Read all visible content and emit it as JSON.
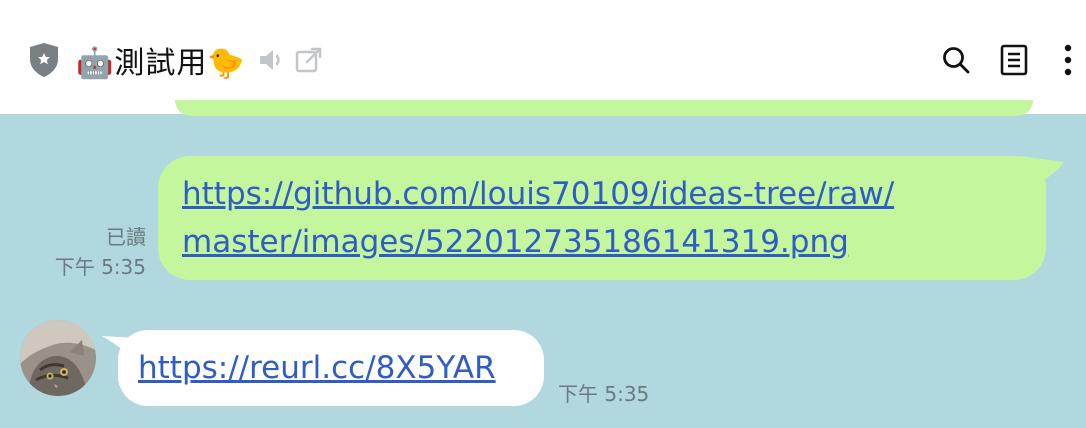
{
  "header": {
    "title": "🤖測試用🐤",
    "icons": [
      "shield-icon",
      "mute-icon",
      "external-link-icon",
      "search-icon",
      "notes-icon",
      "more-vertical-icon"
    ]
  },
  "messages": {
    "outgoing": {
      "link_line1": "https://github.com/louis70109/ideas-tree/raw/",
      "link_line2": "master/images/522012735186141319.png",
      "read_label": "已讀",
      "time": "下午 5:35"
    },
    "incoming": {
      "link": "https://reurl.cc/8X5YAR",
      "time": "下午 5:35"
    }
  },
  "colors": {
    "chat_background": "#b0d8de",
    "outgoing_bubble": "#c3f69d",
    "incoming_bubble": "#ffffff",
    "link": "#2f5cc6"
  }
}
